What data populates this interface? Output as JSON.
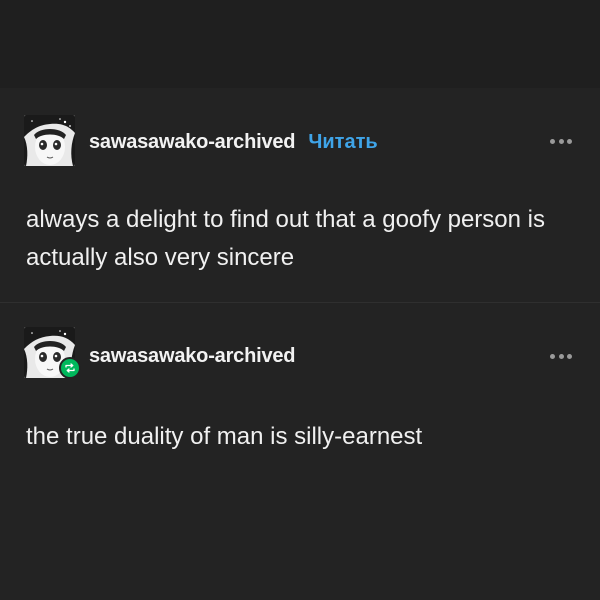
{
  "colors": {
    "background": "#222222",
    "text": "#f0f0f0",
    "follow_link": "#3fa4e8",
    "reblog_badge": "#00b85c"
  },
  "posts": [
    {
      "username": "sawasawako-archived",
      "follow_label": "Читать",
      "text": "always a delight to find out that a goofy person is actually also very sincere",
      "avatar_icon": "manga-girl-avatar",
      "more_icon": "more-options-icon"
    },
    {
      "username": "sawasawako-archived",
      "text": "the true duality of man is silly-earnest",
      "avatar_icon": "manga-girl-avatar",
      "badge_icon": "reblog-icon",
      "more_icon": "more-options-icon"
    }
  ]
}
